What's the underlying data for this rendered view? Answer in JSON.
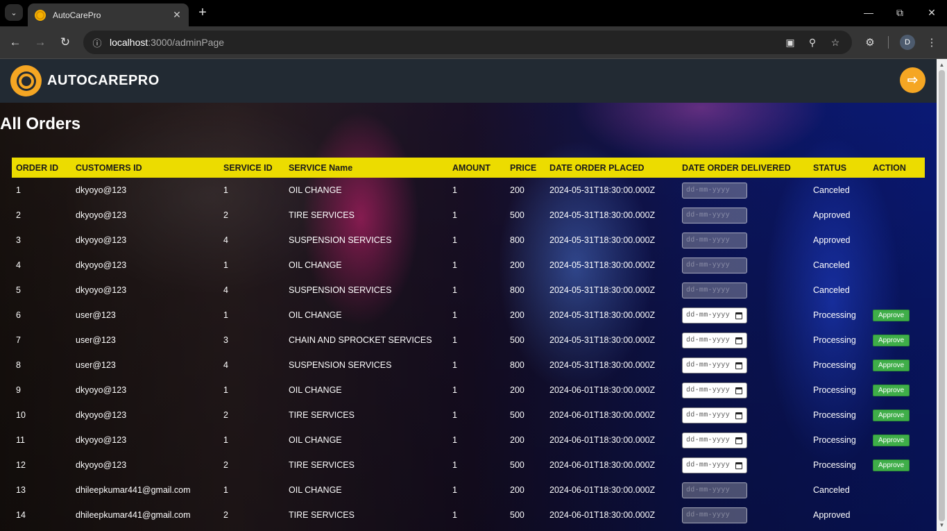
{
  "browser": {
    "tab_title": "AutoCarePro",
    "url_host": "localhost",
    "url_path": ":3000/adminPage",
    "profile_initial": "D"
  },
  "app": {
    "brand": "AUTOCAREPRO",
    "page_title": "All Orders"
  },
  "table": {
    "headers": [
      "ORDER ID",
      "CUSTOMERS ID",
      "SERVICE ID",
      "SERVICE Name",
      "AMOUNT",
      "PRICE",
      "DATE ORDER PLACED",
      "DATE ORDER DELIVERED",
      "STATUS",
      "ACTION"
    ],
    "date_placeholder": "dd-mm-yyyy",
    "approve_label": "Approve",
    "rows": [
      {
        "order_id": "1",
        "customer_id": "dkyoyo@123",
        "service_id": "1",
        "service_name": "OIL CHANGE",
        "amount": "1",
        "price": "200",
        "date_placed": "2024-05-31T18:30:00.000Z",
        "status": "Canceled",
        "editable": false
      },
      {
        "order_id": "2",
        "customer_id": "dkyoyo@123",
        "service_id": "2",
        "service_name": "TIRE SERVICES",
        "amount": "1",
        "price": "500",
        "date_placed": "2024-05-31T18:30:00.000Z",
        "status": "Approved",
        "editable": false
      },
      {
        "order_id": "3",
        "customer_id": "dkyoyo@123",
        "service_id": "4",
        "service_name": "SUSPENSION SERVICES",
        "amount": "1",
        "price": "800",
        "date_placed": "2024-05-31T18:30:00.000Z",
        "status": "Approved",
        "editable": false
      },
      {
        "order_id": "4",
        "customer_id": "dkyoyo@123",
        "service_id": "1",
        "service_name": "OIL CHANGE",
        "amount": "1",
        "price": "200",
        "date_placed": "2024-05-31T18:30:00.000Z",
        "status": "Canceled",
        "editable": false
      },
      {
        "order_id": "5",
        "customer_id": "dkyoyo@123",
        "service_id": "4",
        "service_name": "SUSPENSION SERVICES",
        "amount": "1",
        "price": "800",
        "date_placed": "2024-05-31T18:30:00.000Z",
        "status": "Canceled",
        "editable": false
      },
      {
        "order_id": "6",
        "customer_id": "user@123",
        "service_id": "1",
        "service_name": "OIL CHANGE",
        "amount": "1",
        "price": "200",
        "date_placed": "2024-05-31T18:30:00.000Z",
        "status": "Processing",
        "editable": true
      },
      {
        "order_id": "7",
        "customer_id": "user@123",
        "service_id": "3",
        "service_name": "CHAIN AND SPROCKET SERVICES",
        "amount": "1",
        "price": "500",
        "date_placed": "2024-05-31T18:30:00.000Z",
        "status": "Processing",
        "editable": true
      },
      {
        "order_id": "8",
        "customer_id": "user@123",
        "service_id": "4",
        "service_name": "SUSPENSION SERVICES",
        "amount": "1",
        "price": "800",
        "date_placed": "2024-05-31T18:30:00.000Z",
        "status": "Processing",
        "editable": true
      },
      {
        "order_id": "9",
        "customer_id": "dkyoyo@123",
        "service_id": "1",
        "service_name": "OIL CHANGE",
        "amount": "1",
        "price": "200",
        "date_placed": "2024-06-01T18:30:00.000Z",
        "status": "Processing",
        "editable": true
      },
      {
        "order_id": "10",
        "customer_id": "dkyoyo@123",
        "service_id": "2",
        "service_name": "TIRE SERVICES",
        "amount": "1",
        "price": "500",
        "date_placed": "2024-06-01T18:30:00.000Z",
        "status": "Processing",
        "editable": true
      },
      {
        "order_id": "11",
        "customer_id": "dkyoyo@123",
        "service_id": "1",
        "service_name": "OIL CHANGE",
        "amount": "1",
        "price": "200",
        "date_placed": "2024-06-01T18:30:00.000Z",
        "status": "Processing",
        "editable": true
      },
      {
        "order_id": "12",
        "customer_id": "dkyoyo@123",
        "service_id": "2",
        "service_name": "TIRE SERVICES",
        "amount": "1",
        "price": "500",
        "date_placed": "2024-06-01T18:30:00.000Z",
        "status": "Processing",
        "editable": true
      },
      {
        "order_id": "13",
        "customer_id": "dhileepkumar441@gmail.com",
        "service_id": "1",
        "service_name": "OIL CHANGE",
        "amount": "1",
        "price": "200",
        "date_placed": "2024-06-01T18:30:00.000Z",
        "status": "Canceled",
        "editable": false
      },
      {
        "order_id": "14",
        "customer_id": "dhileepkumar441@gmail.com",
        "service_id": "2",
        "service_name": "TIRE SERVICES",
        "amount": "1",
        "price": "500",
        "date_placed": "2024-06-01T18:30:00.000Z",
        "status": "Approved",
        "editable": false
      }
    ]
  },
  "colors": {
    "header_bg": "#ecdc00",
    "accent": "#f5a623",
    "navbar_bg": "#222a33",
    "approve_green": "#3fae49"
  }
}
